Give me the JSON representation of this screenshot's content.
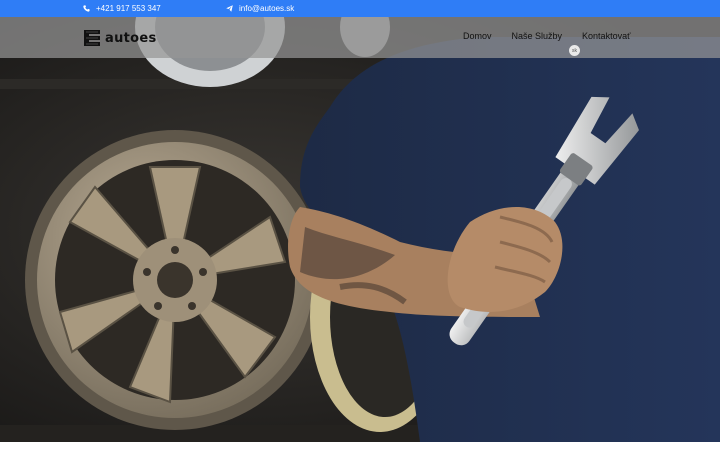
{
  "topbar": {
    "phone": "+421 917 553 347",
    "email": "info@autoes.sk",
    "phone_icon": "phone-icon",
    "email_icon": "paper-plane-icon",
    "background": "#2f7df6"
  },
  "header": {
    "logo_text": "autoes",
    "logo_icon": "autoes-logo-icon",
    "nav": [
      {
        "label": "Domov"
      },
      {
        "label": "Naše Služby"
      },
      {
        "label": "Kontaktovať"
      }
    ],
    "lang_badge": "sk"
  },
  "hero": {
    "image": "mechanic-holding-wrench-with-wheels"
  }
}
